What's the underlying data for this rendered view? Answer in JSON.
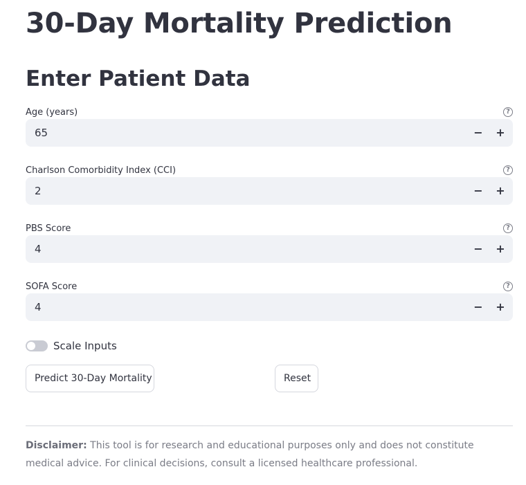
{
  "page": {
    "title": "30-Day Mortality Prediction",
    "section_title": "Enter Patient Data"
  },
  "fields": [
    {
      "label": "Age (years)",
      "value": "65",
      "help_icon": "question-circle-icon"
    },
    {
      "label": "Charlson Comorbidity Index (CCI)",
      "value": "2",
      "help_icon": "question-circle-icon"
    },
    {
      "label": "PBS Score",
      "value": "4",
      "help_icon": "question-circle-icon"
    },
    {
      "label": "SOFA Score",
      "value": "4",
      "help_icon": "question-circle-icon"
    }
  ],
  "stepper": {
    "minus": "−",
    "plus": "+"
  },
  "toggle": {
    "label": "Scale Inputs",
    "on": false
  },
  "buttons": {
    "predict": "Predict 30-Day Mortality",
    "reset": "Reset"
  },
  "disclaimer": {
    "bold": "Disclaimer:",
    "text": " This tool is for research and educational purposes only and does not constitute medical advice. For clinical decisions, consult a licensed healthcare professional."
  },
  "colors": {
    "text": "#31333f",
    "input_bg": "#f0f2f6",
    "muted": "#7a7c86"
  }
}
